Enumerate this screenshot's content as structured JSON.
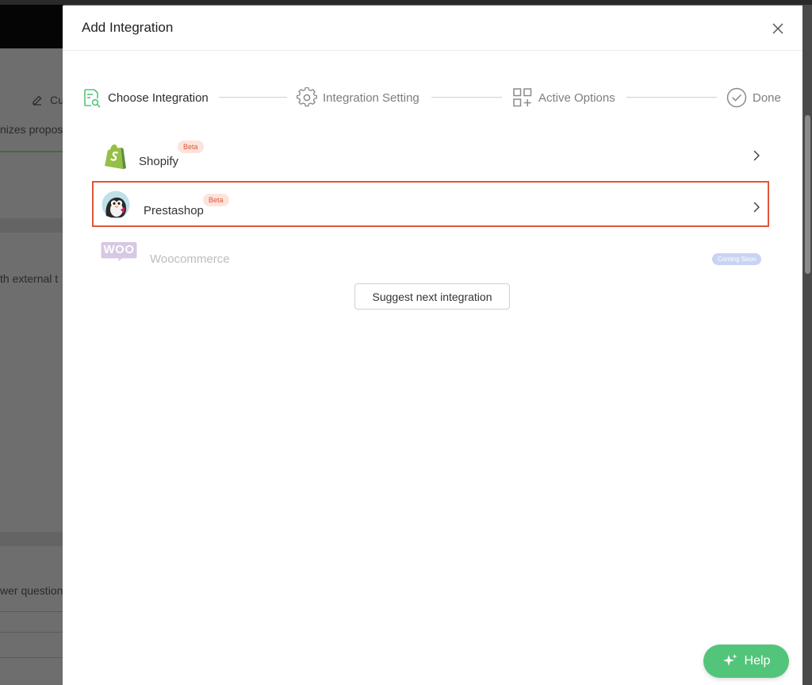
{
  "background": {
    "fragment_1": "Cu",
    "fragment_2": "nizes propos",
    "fragment_3": "th external t",
    "fragment_4": "wer question"
  },
  "modal": {
    "title": "Add Integration",
    "close_icon": "close-icon"
  },
  "stepper": {
    "steps": [
      {
        "label": "Choose Integration",
        "icon": "document-search-icon",
        "state": "active"
      },
      {
        "label": "Integration Setting",
        "icon": "gear-icon",
        "state": "inactive"
      },
      {
        "label": "Active Options",
        "icon": "grid-add-icon",
        "state": "inactive"
      },
      {
        "label": "Done",
        "icon": "check-circle-icon",
        "state": "inactive"
      }
    ]
  },
  "integrations": [
    {
      "name": "Shopify",
      "badge": "Beta",
      "logo": "shopify-logo",
      "enabled": true
    },
    {
      "name": "Prestashop",
      "badge": "Beta",
      "logo": "prestashop-logo",
      "enabled": true
    },
    {
      "name": "Woocommerce",
      "badge": "Coming Soon",
      "logo": "woo-logo",
      "logo_text": "WOO",
      "enabled": false
    }
  ],
  "suggest_button": "Suggest next integration",
  "help_button": "Help",
  "colors": {
    "accent_green": "#53c57a",
    "highlight_border": "#e0553a",
    "beta_badge_bg": "#fde3dc",
    "coming_soon_bg": "#c9d4f4"
  }
}
